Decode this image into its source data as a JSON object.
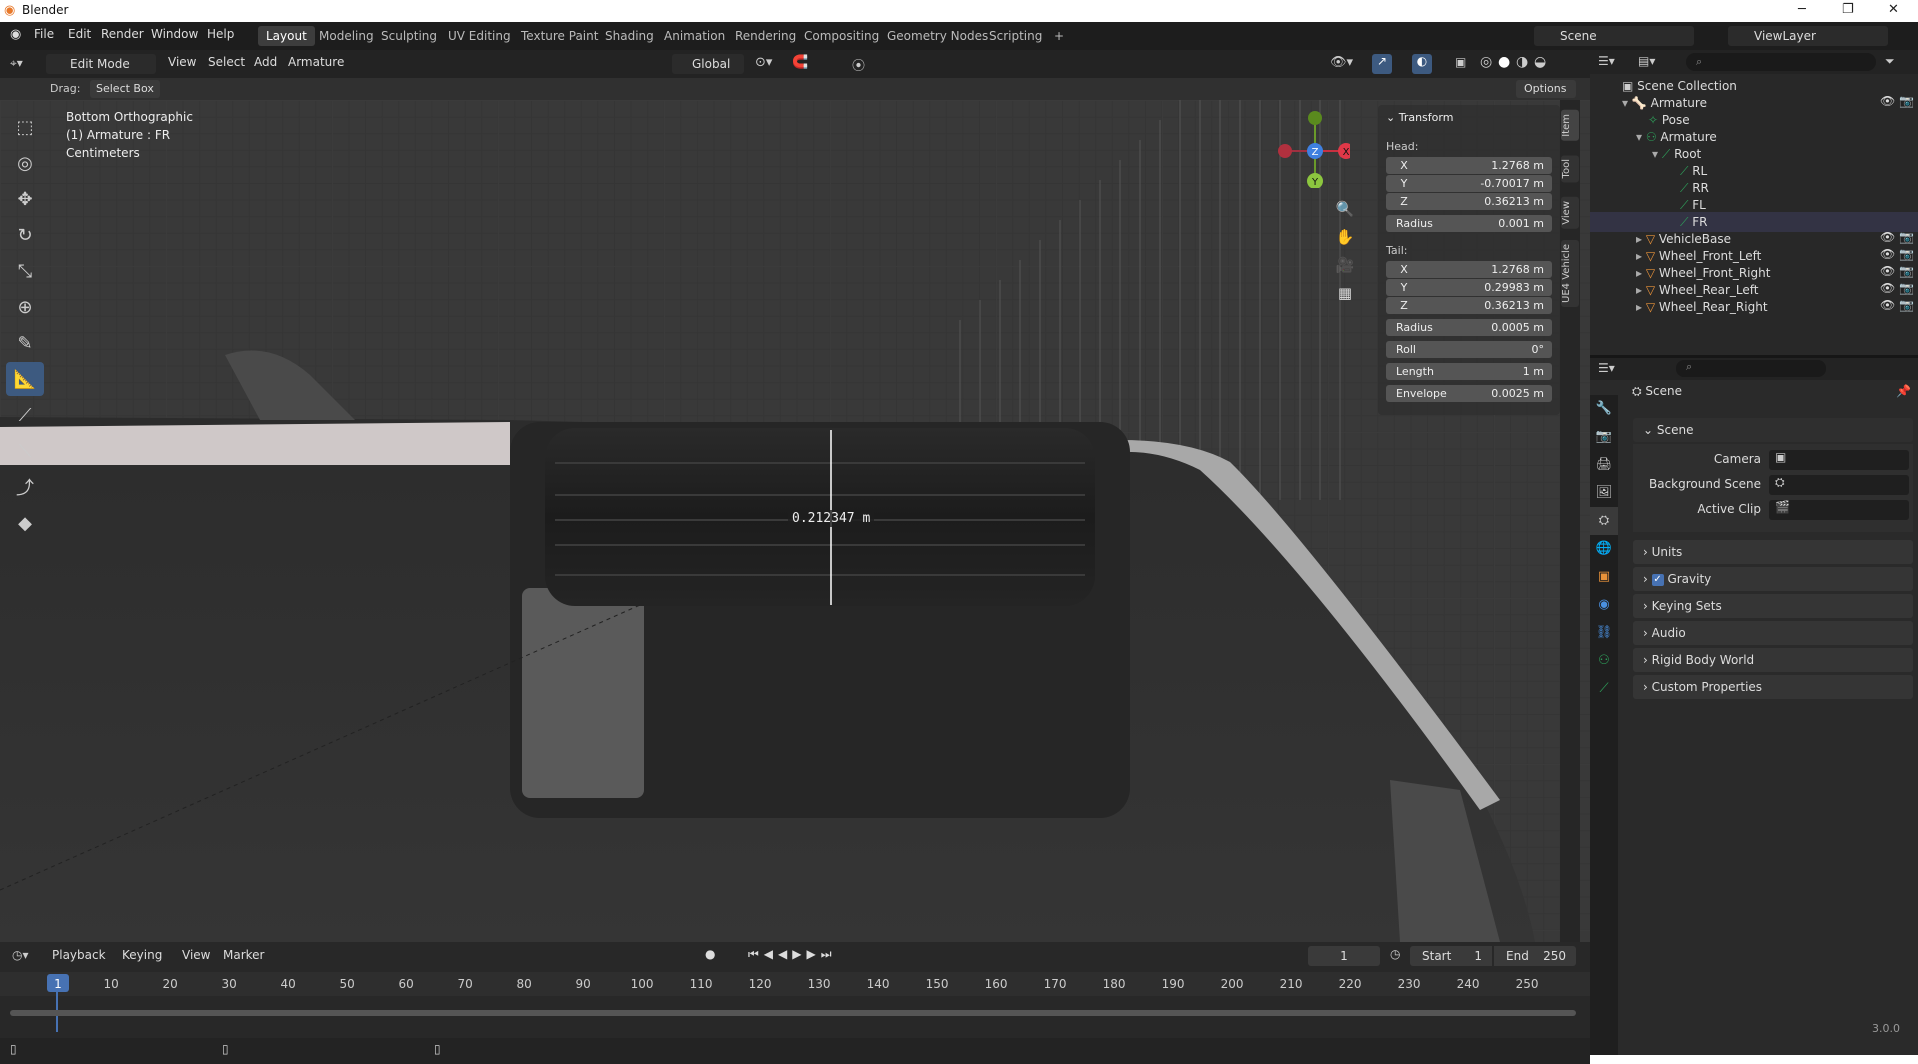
{
  "window": {
    "title": "Blender",
    "min": "─",
    "max": "❐",
    "close": "✕"
  },
  "menubar": {
    "items": [
      "File",
      "Edit",
      "Render",
      "Window",
      "Help"
    ]
  },
  "workspaces": [
    "Layout",
    "Modeling",
    "Sculpting",
    "UV Editing",
    "Texture Paint",
    "Shading",
    "Animation",
    "Rendering",
    "Compositing",
    "Geometry Nodes",
    "Scripting",
    "+"
  ],
  "active_workspace": "Layout",
  "scene_field": "Scene",
  "viewlayer_field": "ViewLayer",
  "header": {
    "mode": "Edit Mode",
    "menus": [
      "View",
      "Select",
      "Add",
      "Armature"
    ],
    "orientation": "Global"
  },
  "toolsettings": {
    "drag_label": "Drag:",
    "drag_value": "Select Box",
    "options": "Options"
  },
  "viewport": {
    "info": [
      "Bottom Orthographic",
      "(1) Armature : FR",
      "Centimeters"
    ],
    "measure": "0.212347 m"
  },
  "gizmo": {
    "x": "X",
    "y": "Y",
    "z": "Z"
  },
  "npanel": {
    "section": "Transform",
    "head_label": "Head:",
    "tail_label": "Tail:",
    "head": [
      {
        "k": "X",
        "v": "1.2768 m"
      },
      {
        "k": "Y",
        "v": "-0.70017 m"
      },
      {
        "k": "Z",
        "v": "0.36213 m"
      }
    ],
    "head_radius": {
      "k": "Radius",
      "v": "0.001 m"
    },
    "tail": [
      {
        "k": "X",
        "v": "1.2768 m"
      },
      {
        "k": "Y",
        "v": "0.29983 m"
      },
      {
        "k": "Z",
        "v": "0.36213 m"
      }
    ],
    "tail_fields": [
      {
        "k": "Radius",
        "v": "0.0005 m"
      },
      {
        "k": "Roll",
        "v": "0°"
      },
      {
        "k": "Length",
        "v": "1 m"
      },
      {
        "k": "Envelope",
        "v": "0.0025 m"
      }
    ],
    "tabs": [
      "Item",
      "Tool",
      "View",
      "UE4 Vehicle"
    ]
  },
  "outliner": {
    "root": "Scene Collection",
    "items": [
      {
        "name": "Armature",
        "indent": 0
      },
      {
        "name": "Pose",
        "indent": 1
      },
      {
        "name": "Armature",
        "indent": 1
      },
      {
        "name": "Root",
        "indent": 2
      },
      {
        "name": "RL",
        "indent": 3
      },
      {
        "name": "RR",
        "indent": 3
      },
      {
        "name": "FL",
        "indent": 3
      },
      {
        "name": "FR",
        "indent": 3
      },
      {
        "name": "VehicleBase",
        "indent": 0
      },
      {
        "name": "Wheel_Front_Left",
        "indent": 0
      },
      {
        "name": "Wheel_Front_Right",
        "indent": 0
      },
      {
        "name": "Wheel_Rear_Left",
        "indent": 0
      },
      {
        "name": "Wheel_Rear_Right",
        "indent": 0
      }
    ]
  },
  "properties": {
    "context": "Scene",
    "panel": "Scene",
    "camera_label": "Camera",
    "bg_label": "Background Scene",
    "clip_label": "Active Clip",
    "sections": [
      "Units",
      "Gravity",
      "Keying Sets",
      "Audio",
      "Rigid Body World",
      "Custom Properties"
    ]
  },
  "timeline": {
    "menus": [
      "Playback",
      "Keying",
      "View",
      "Marker"
    ],
    "current": "1",
    "start_label": "Start",
    "start": "1",
    "end_label": "End",
    "end": "250",
    "ticks": [
      "1",
      "10",
      "20",
      "30",
      "40",
      "50",
      "60",
      "70",
      "80",
      "90",
      "100",
      "110",
      "120",
      "130",
      "140",
      "150",
      "160",
      "170",
      "180",
      "190",
      "200",
      "210",
      "220",
      "230",
      "240",
      "250"
    ]
  },
  "version": "3.0.0",
  "colors": {
    "accent": "#4772b3",
    "bone": "#2ea05a",
    "mesh": "#e8923a"
  }
}
